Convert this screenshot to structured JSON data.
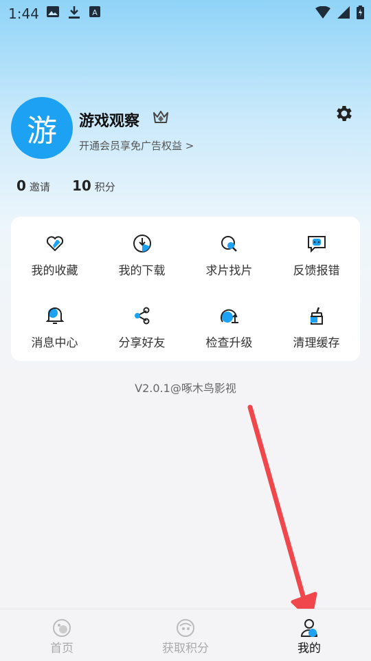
{
  "status_bar": {
    "time": "1:44"
  },
  "profile": {
    "avatar_char": "游",
    "username": "游戏观察",
    "vip_prompt": "开通会员享免广告权益 >"
  },
  "stats": [
    {
      "value": "0",
      "label": "邀请"
    },
    {
      "value": "10",
      "label": "积分"
    }
  ],
  "menu": [
    {
      "label": "我的收藏",
      "icon": "heart-icon"
    },
    {
      "label": "我的下载",
      "icon": "download-icon"
    },
    {
      "label": "求片找片",
      "icon": "search-film-icon"
    },
    {
      "label": "反馈报错",
      "icon": "feedback-icon"
    },
    {
      "label": "消息中心",
      "icon": "bell-icon"
    },
    {
      "label": "分享好友",
      "icon": "share-icon"
    },
    {
      "label": "检查升级",
      "icon": "upgrade-icon"
    },
    {
      "label": "清理缓存",
      "icon": "clean-cache-icon"
    }
  ],
  "version": "V2.0.1@啄木鸟影视",
  "tabs": [
    {
      "label": "首页",
      "icon": "home-icon",
      "active": false
    },
    {
      "label": "获取积分",
      "icon": "points-icon",
      "active": false
    },
    {
      "label": "我的",
      "icon": "profile-icon",
      "active": true
    }
  ],
  "colors": {
    "accent": "#1da1f2",
    "annotation_arrow": "#f0474d"
  }
}
